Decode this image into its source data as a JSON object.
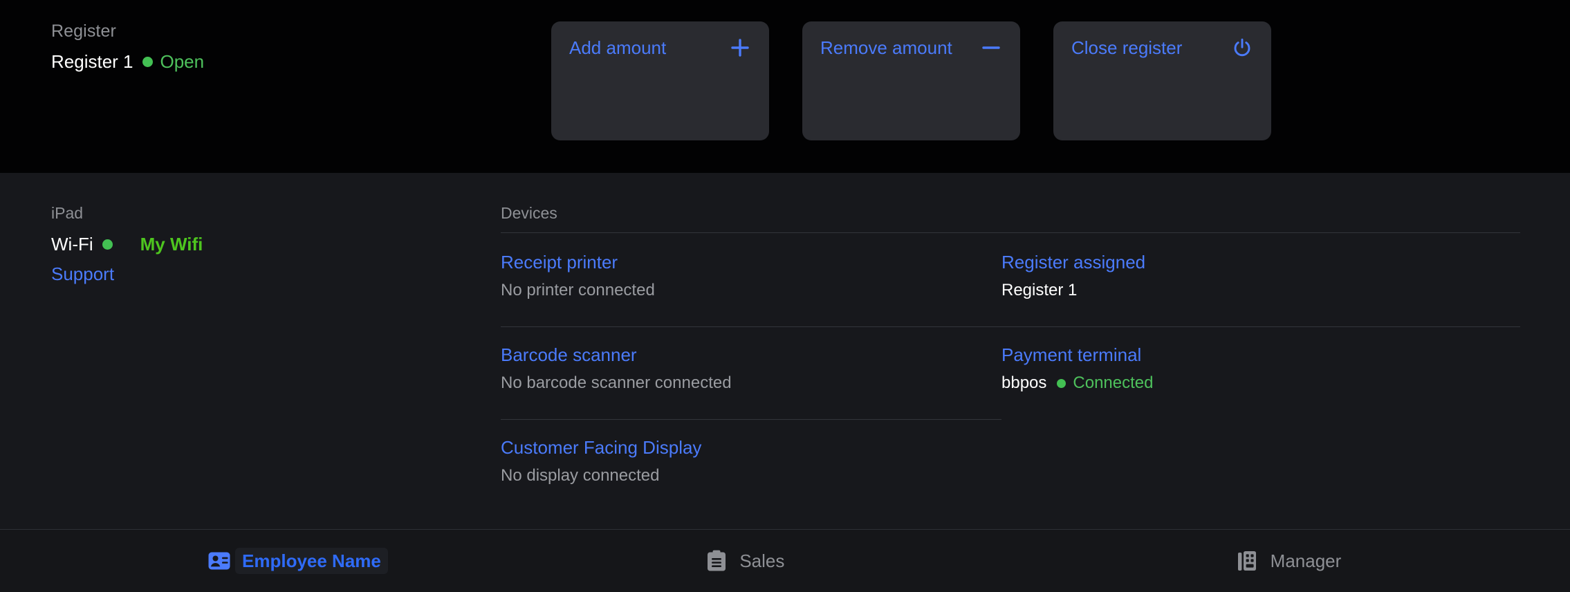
{
  "register": {
    "section_label": "Register",
    "name": "Register 1",
    "status": "Open",
    "status_color": "#4ec15c"
  },
  "actions": [
    {
      "label": "Add amount",
      "icon": "plus-icon"
    },
    {
      "label": "Remove amount",
      "icon": "minus-icon"
    },
    {
      "label": "Close register",
      "icon": "power-icon"
    }
  ],
  "device_info": {
    "section_label": "iPad",
    "wifi_label": "Wi-Fi",
    "wifi_network": "My Wifi",
    "wifi_color": "#4ec51f",
    "support_label": "Support"
  },
  "devices": {
    "section_label": "Devices",
    "items": [
      {
        "title": "Receipt printer",
        "subtitle": "No printer connected"
      },
      {
        "title": "Barcode scanner",
        "subtitle": "No barcode scanner connected"
      },
      {
        "title": "Customer Facing Display",
        "subtitle": "No display connected"
      }
    ]
  },
  "assigned": {
    "section_label": "",
    "items": [
      {
        "title": "Register assigned",
        "value": "Register 1",
        "status": "",
        "has_status": false
      },
      {
        "title": "Payment terminal",
        "value": "bbpos",
        "status": "Connected",
        "has_status": true
      }
    ]
  },
  "bottom_nav": {
    "tabs": [
      {
        "label": "Employee Name",
        "icon": "id-badge-icon",
        "active": true
      },
      {
        "label": "Sales",
        "icon": "clipboard-icon",
        "active": false
      },
      {
        "label": "Manager",
        "icon": "building-icon",
        "active": false
      }
    ]
  },
  "colors": {
    "accent_blue": "#4b7bfb",
    "active_blue": "#2f6bf7",
    "status_green": "#4ec15c",
    "muted_gray": "#8e9095",
    "panel_bg": "#17181c",
    "top_bg": "#020203",
    "card_bg": "#2a2b30"
  }
}
